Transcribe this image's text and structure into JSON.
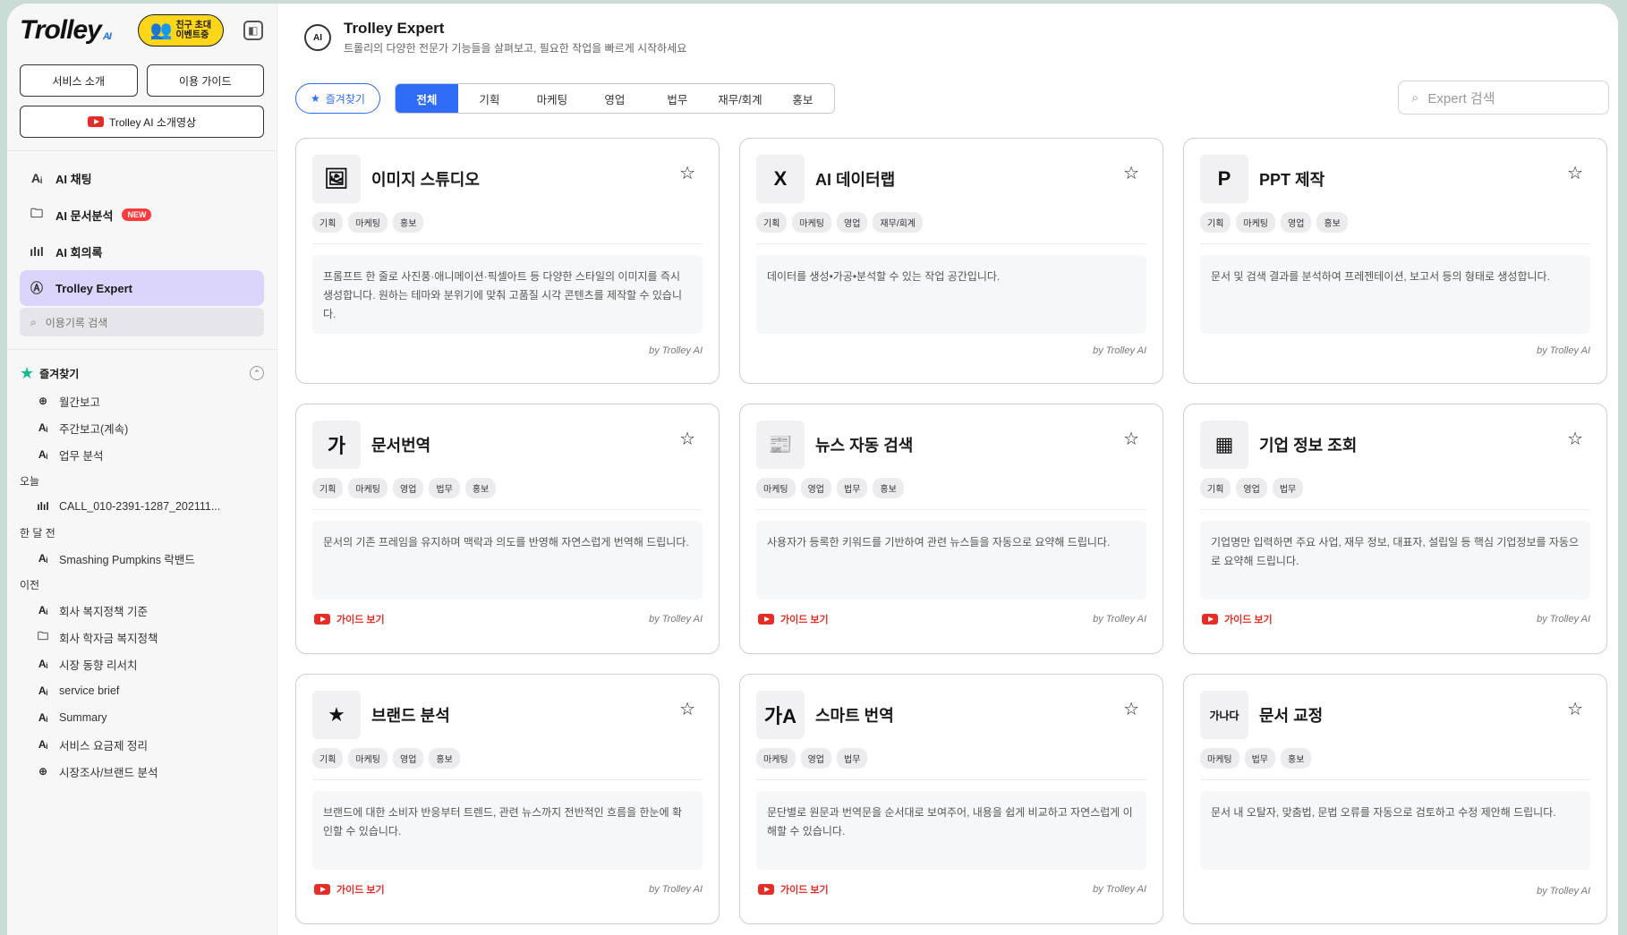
{
  "sidebar": {
    "logo": "Trolley",
    "logo_sub": "AI",
    "invite_line1": "친구 초대",
    "invite_line2": "이벤트중",
    "btn_intro": "서비스 소개",
    "btn_guide": "이용 가이드",
    "btn_video": "Trolley AI 소개영상",
    "nav": [
      {
        "label": "AI 채팅",
        "icon": "AI"
      },
      {
        "label": "AI 문서분석",
        "icon": "doc",
        "badge": "NEW"
      },
      {
        "label": "AI 회의록",
        "icon": "wave"
      },
      {
        "label": "Trolley Expert",
        "icon": "AI"
      }
    ],
    "history_search_placeholder": "이용기록 검색",
    "favorites_label": "즐겨찾기",
    "favorites": [
      "월간보고",
      "주간보고(계속)",
      "업무 분석"
    ],
    "today_label": "오늘",
    "today": [
      "CALL_010-2391-1287_202111..."
    ],
    "month_label": "한 달 전",
    "month": [
      "Smashing Pumpkins 락밴드"
    ],
    "older_label": "이전",
    "older": [
      "회사 복지정책 기준",
      "회사 학자금 복지정책",
      "시장 동향 리서치",
      "service brief",
      "Summary",
      "서비스 요금제 정리",
      "시장조사/브랜드 분석"
    ]
  },
  "header": {
    "title": "Trolley Expert",
    "subtitle": "트롤리의 다양한 전문가 기능들을 살펴보고, 필요한 작업을 빠르게 시작하세요",
    "logo_text": "AI"
  },
  "toolbar": {
    "favorites": "즐겨찾기",
    "tabs": [
      "전체",
      "기획",
      "마케팅",
      "영업",
      "법무",
      "재무/회계",
      "홍보"
    ],
    "search_placeholder": "Expert 검색"
  },
  "cards": [
    {
      "title": "이미지 스튜디오",
      "icon": "🖼",
      "tags": [
        "기획",
        "마케팅",
        "홍보"
      ],
      "desc": "프롬프트 한 줄로 사진풍·애니메이션·픽셀아트 등 다양한 스타일의 이미지를 즉시 생성합니다. 원하는 테마와 분위기에 맞춰 고품질 시각 콘텐츠를 제작할 수 있습니다.",
      "guide": "",
      "by": "by Trolley AI"
    },
    {
      "title": "AI 데이터랩",
      "icon": "X",
      "tags": [
        "기획",
        "마케팅",
        "영업",
        "재무/회계"
      ],
      "desc": "데이터를 생성•가공•분석할 수 있는 작업 공간입니다.",
      "guide": "",
      "by": "by Trolley AI"
    },
    {
      "title": "PPT 제작",
      "icon": "P",
      "tags": [
        "기획",
        "마케팅",
        "영업",
        "홍보"
      ],
      "desc": "문서 및 검색 결과를 분석하여 프레젠테이션, 보고서 등의 형태로 생성합니다.",
      "guide": "",
      "by": "by Trolley AI"
    },
    {
      "title": "문서번역",
      "icon": "가",
      "tags": [
        "기획",
        "마케팅",
        "영업",
        "법무",
        "홍보"
      ],
      "desc": "문서의 기존 프레임을 유지하며 맥락과 의도를 반영해 자연스럽게 번역해 드립니다.",
      "guide": "가이드 보기",
      "by": "by Trolley AI"
    },
    {
      "title": "뉴스 자동 검색",
      "icon": "📰",
      "tags": [
        "마케팅",
        "영업",
        "법무",
        "홍보"
      ],
      "desc": "사용자가 등록한 키워드를 기반하여 관련 뉴스들을 자동으로 요약해 드립니다.",
      "guide": "가이드 보기",
      "by": "by Trolley AI"
    },
    {
      "title": "기업 정보 조회",
      "icon": "▦",
      "tags": [
        "기획",
        "영업",
        "법무"
      ],
      "desc": "기업명만 입력하면 주요 사업, 재무 정보, 대표자, 설립일 등 핵심 기업정보를 자동으로 요약해 드립니다.",
      "guide": "가이드 보기",
      "by": "by Trolley AI"
    },
    {
      "title": "브랜드 분석",
      "icon": "★",
      "tags": [
        "기획",
        "마케팅",
        "영업",
        "홍보"
      ],
      "desc": "브랜드에 대한 소비자 반응부터 트렌드, 관련 뉴스까지 전반적인 흐름을 한눈에 확인할 수 있습니다.",
      "guide": "가이드 보기",
      "by": "by Trolley AI"
    },
    {
      "title": "스마트 번역",
      "icon": "가A",
      "tags": [
        "마케팅",
        "영업",
        "법무"
      ],
      "desc": "문단별로 원문과 번역문을 순서대로 보여주어, 내용을 쉽게 비교하고 자연스럽게 이해할 수 있습니다.",
      "guide": "가이드 보기",
      "by": "by Trolley AI"
    },
    {
      "title": "문서 교정",
      "icon": "가나다",
      "tags": [
        "마케팅",
        "법무",
        "홍보"
      ],
      "desc": "문서 내 오탈자, 맞춤법, 문법 오류를 자동으로 검토하고 수정 제안해 드립니다.",
      "guide": "",
      "by": "by Trolley AI"
    }
  ],
  "colors": {
    "accent": "#2f6cf5",
    "active_nav": "#dcd5fb",
    "invite": "#ffd61a",
    "youtube": "#e52d27",
    "star": "#16b98f"
  }
}
